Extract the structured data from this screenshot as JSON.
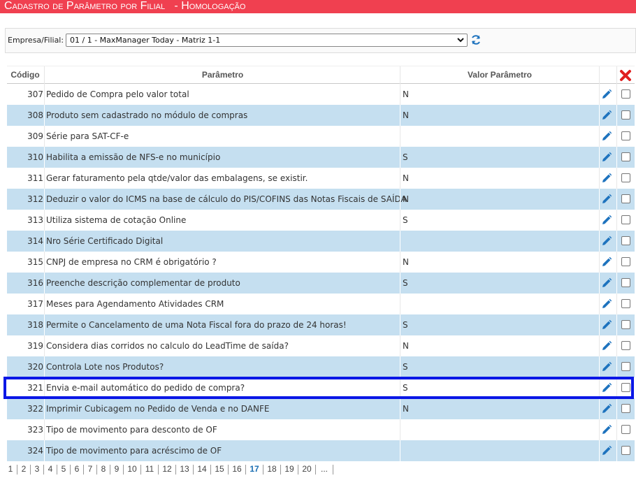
{
  "title": "Cadastro de Parâmetro por Filial   - Homologação",
  "filter": {
    "label": "Empresa/Filial:",
    "selected": "01 / 1 - MaxManager Today - Matriz 1-1"
  },
  "table": {
    "headers": {
      "code": "Código",
      "param": "Parâmetro",
      "value": "Valor Parâmetro"
    },
    "rows": [
      {
        "code": "307",
        "param": "Pedido de Compra pelo valor total",
        "value": "N"
      },
      {
        "code": "308",
        "param": "Produto sem cadastrado no módulo de compras",
        "value": "N"
      },
      {
        "code": "309",
        "param": "Série para SAT-CF-e",
        "value": ""
      },
      {
        "code": "310",
        "param": "Habilita a emissão de NFS-e no município",
        "value": "S"
      },
      {
        "code": "311",
        "param": "Gerar faturamento pela qtde/valor das embalagens, se existir.",
        "value": "N"
      },
      {
        "code": "312",
        "param": "Deduzir o valor do ICMS na base de cálculo do PIS/COFINS das Notas Fiscais de SAÍDA",
        "value": "N"
      },
      {
        "code": "313",
        "param": "Utiliza sistema de cotação Online",
        "value": "S"
      },
      {
        "code": "314",
        "param": "Nro Série Certificado Digital",
        "value": ""
      },
      {
        "code": "315",
        "param": "CNPJ de empresa no CRM é obrigatório ?",
        "value": "N"
      },
      {
        "code": "316",
        "param": "Preenche descrição complementar de produto",
        "value": "S"
      },
      {
        "code": "317",
        "param": "Meses para Agendamento Atividades CRM",
        "value": ""
      },
      {
        "code": "318",
        "param": "Permite o Cancelamento de uma Nota Fiscal fora do prazo de 24 horas!",
        "value": "S"
      },
      {
        "code": "319",
        "param": "Considera dias corridos no calculo do LeadTime de saída?",
        "value": "N"
      },
      {
        "code": "320",
        "param": "Controla Lote nos Produtos?",
        "value": "S"
      },
      {
        "code": "321",
        "param": "Envia e-mail automático do pedido de compra?",
        "value": "S"
      },
      {
        "code": "322",
        "param": "Imprimir Cubicagem no Pedido de Venda e no DANFE",
        "value": "N"
      },
      {
        "code": "323",
        "param": "Tipo de movimento para desconto de OF",
        "value": ""
      },
      {
        "code": "324",
        "param": "Tipo de movimento para acréscimo de OF",
        "value": ""
      }
    ]
  },
  "pager": {
    "pages": [
      "1",
      "2",
      "3",
      "4",
      "5",
      "6",
      "7",
      "8",
      "9",
      "10",
      "11",
      "12",
      "13",
      "14",
      "15",
      "16",
      "17",
      "18",
      "19",
      "20",
      "..."
    ],
    "current": "17"
  },
  "colors": {
    "title_bar": "#f04050",
    "row_alt": "#c5dff0",
    "highlight": "#0a17e6",
    "edit_icon": "#1e73be",
    "delete_icon": "#e02020"
  },
  "icons": {
    "refresh": "refresh-icon",
    "edit": "pencil-icon",
    "delete": "close-icon"
  }
}
